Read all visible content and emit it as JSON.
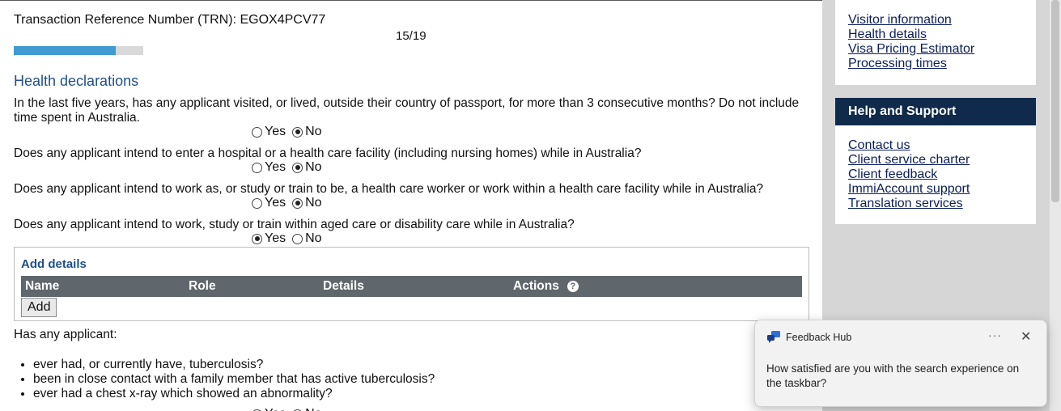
{
  "header": {
    "trn_text": "Transaction Reference Number (TRN): EGOX4PCV77",
    "progress_text": "15/19",
    "progress_fraction": 0.789
  },
  "section": {
    "title": "Health declarations"
  },
  "questions": [
    {
      "text": "In the last five years, has any applicant visited, or lived, outside their country of passport, for more than 3 consecutive months? Do not include time spent in Australia.",
      "selected": "No"
    },
    {
      "text": "Does any applicant intend to enter a hospital or a health care facility (including nursing homes) while in Australia?",
      "selected": "No"
    },
    {
      "text": "Does any applicant intend to work as, or study or train to be, a health care worker or work within a health care facility while in Australia?",
      "selected": "No"
    },
    {
      "text": "Does any applicant intend to work, study or train within aged care or disability care while in Australia?",
      "selected": "Yes"
    }
  ],
  "options": {
    "yes": "Yes",
    "no": "No"
  },
  "add_details": {
    "title": "Add details",
    "columns": [
      "Name",
      "Role",
      "Details",
      "Actions"
    ],
    "help_icon": "?",
    "add_label": "Add"
  },
  "has_any": {
    "intro": "Has any applicant:",
    "bullets": [
      "ever had, or currently have, tuberculosis?",
      "been in close contact with a family member that has active tuberculosis?",
      "ever had a chest x-ray which showed an abnormality?"
    ]
  },
  "sidebar": {
    "links_top": [
      "Visitor information",
      "Health details",
      "Visa Pricing Estimator",
      "Processing times"
    ],
    "help_title": "Help and Support",
    "help_links": [
      "Contact us",
      "Client service charter",
      "Client feedback",
      "ImmiAccount support",
      "Translation services"
    ]
  },
  "toast": {
    "app_name": "Feedback Hub",
    "more": "···",
    "close": "✕",
    "message": "How satisfied are you with the search experience on the taskbar?"
  },
  "colors": {
    "accent": "#3f9bd2",
    "heading": "#1f4e8c",
    "table_header": "#5f666c",
    "sidebar_head": "#0f2a4a"
  }
}
